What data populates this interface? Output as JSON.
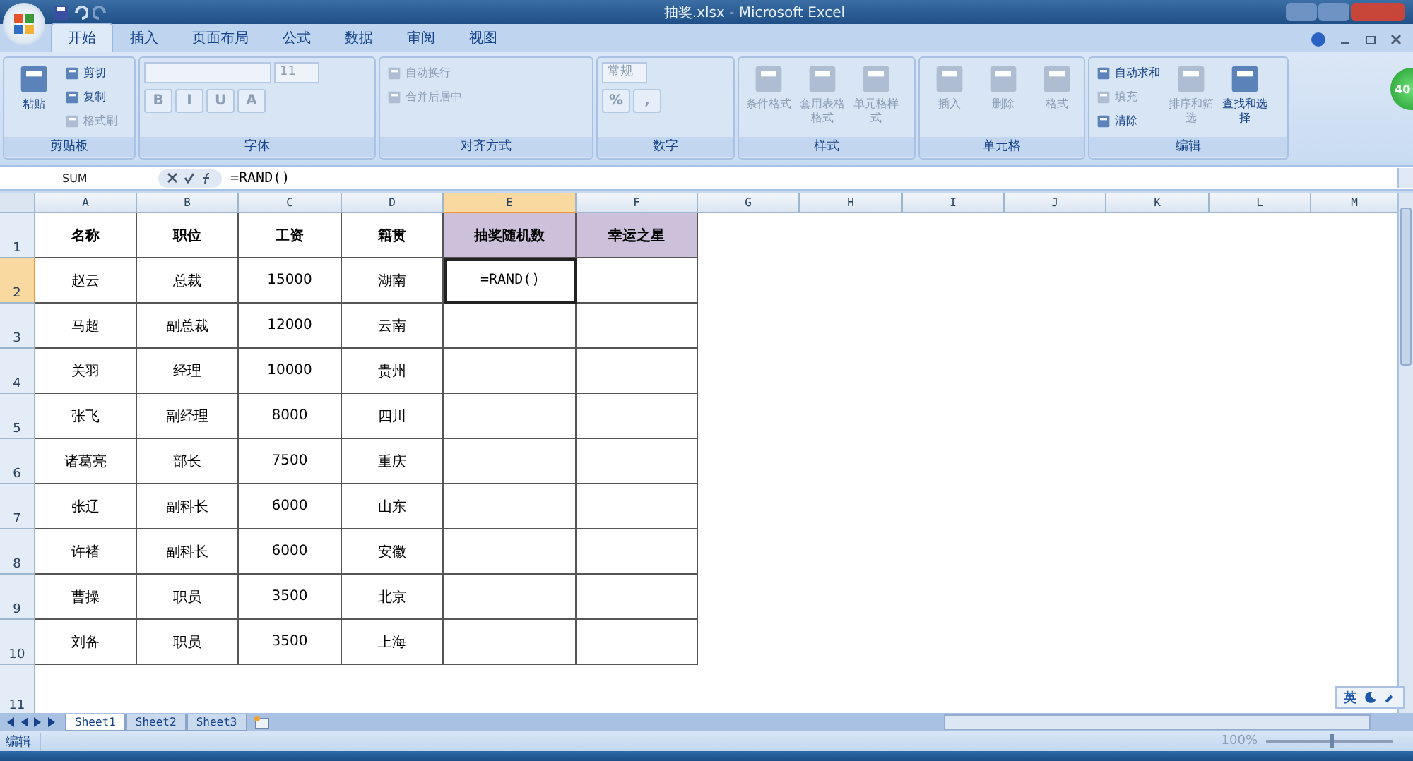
{
  "window": {
    "title": "抽奖.xlsx - Microsoft Excel"
  },
  "ribbon_tabs": [
    {
      "label": "开始",
      "selected": true
    },
    {
      "label": "插入",
      "selected": false
    },
    {
      "label": "页面布局",
      "selected": false
    },
    {
      "label": "公式",
      "selected": false
    },
    {
      "label": "数据",
      "selected": false
    },
    {
      "label": "审阅",
      "selected": false
    },
    {
      "label": "视图",
      "selected": false
    }
  ],
  "floating_badge": "40",
  "ribbon_groups": [
    {
      "title": "剪贴板",
      "items": [
        {
          "kind": "large",
          "label": "粘贴",
          "disabled": false
        },
        {
          "kind": "small",
          "label": "剪切",
          "disabled": false
        },
        {
          "kind": "small",
          "label": "复制",
          "disabled": false
        },
        {
          "kind": "small",
          "label": "格式刷",
          "disabled": true
        }
      ]
    },
    {
      "title": "字体",
      "items": [
        {
          "kind": "field",
          "disabled": true
        },
        {
          "kind": "field",
          "label": "11",
          "disabled": true
        },
        {
          "kind": "glyph",
          "label": "B",
          "disabled": true
        },
        {
          "kind": "glyph",
          "label": "I",
          "disabled": true
        },
        {
          "kind": "glyph",
          "label": "U",
          "disabled": true
        },
        {
          "kind": "glyph",
          "label": "A",
          "disabled": true
        }
      ]
    },
    {
      "title": "对齐方式",
      "items": [
        {
          "kind": "small",
          "label": "自动换行",
          "disabled": true
        },
        {
          "kind": "small",
          "label": "合并后居中",
          "disabled": true
        }
      ]
    },
    {
      "title": "数字",
      "items": [
        {
          "kind": "field",
          "label": "常规",
          "disabled": true
        },
        {
          "kind": "glyph",
          "label": "%",
          "disabled": true
        },
        {
          "kind": "glyph",
          "label": ",",
          "disabled": true
        }
      ]
    },
    {
      "title": "样式",
      "items": [
        {
          "kind": "large",
          "label": "条件格式",
          "disabled": true
        },
        {
          "kind": "large",
          "label": "套用表格格式",
          "disabled": true
        },
        {
          "kind": "large",
          "label": "单元格样式",
          "disabled": true
        }
      ]
    },
    {
      "title": "单元格",
      "items": [
        {
          "kind": "large",
          "label": "插入",
          "disabled": true
        },
        {
          "kind": "large",
          "label": "删除",
          "disabled": true
        },
        {
          "kind": "large",
          "label": "格式",
          "disabled": true
        }
      ]
    },
    {
      "title": "编辑",
      "items": [
        {
          "kind": "small",
          "label": "自动求和",
          "disabled": false
        },
        {
          "kind": "small",
          "label": "填充",
          "disabled": true
        },
        {
          "kind": "small",
          "label": "清除",
          "disabled": false
        },
        {
          "kind": "large",
          "label": "排序和筛选",
          "disabled": true
        },
        {
          "kind": "large",
          "label": "查找和选择",
          "disabled": false
        }
      ]
    }
  ],
  "formula_bar": {
    "name_box": "SUM",
    "formula": "=RAND()"
  },
  "columns": [
    {
      "label": "A",
      "selected": false
    },
    {
      "label": "B",
      "selected": false
    },
    {
      "label": "C",
      "selected": false
    },
    {
      "label": "D",
      "selected": false
    },
    {
      "label": "E",
      "selected": true
    },
    {
      "label": "F",
      "selected": false
    },
    {
      "label": "G",
      "selected": false
    },
    {
      "label": "H",
      "selected": false
    },
    {
      "label": "I",
      "selected": false
    },
    {
      "label": "J",
      "selected": false
    },
    {
      "label": "K",
      "selected": false
    },
    {
      "label": "L",
      "selected": false
    },
    {
      "label": "M",
      "selected": false
    }
  ],
  "rows": [
    {
      "number": "1",
      "selected": false,
      "kind": "header",
      "cells": [
        "名称",
        "职位",
        "工资",
        "籍贯",
        "抽奖随机数",
        "幸运之星"
      ]
    },
    {
      "number": "2",
      "selected": true,
      "kind": "data",
      "cells": [
        "赵云",
        "总裁",
        "15000",
        "湖南",
        "=RAND()",
        ""
      ]
    },
    {
      "number": "3",
      "selected": false,
      "kind": "data",
      "cells": [
        "马超",
        "副总裁",
        "12000",
        "云南",
        "",
        ""
      ]
    },
    {
      "number": "4",
      "selected": false,
      "kind": "data",
      "cells": [
        "关羽",
        "经理",
        "10000",
        "贵州",
        "",
        ""
      ]
    },
    {
      "number": "5",
      "selected": false,
      "kind": "data",
      "cells": [
        "张飞",
        "副经理",
        "8000",
        "四川",
        "",
        ""
      ]
    },
    {
      "number": "6",
      "selected": false,
      "kind": "data",
      "cells": [
        "诸葛亮",
        "部长",
        "7500",
        "重庆",
        "",
        ""
      ]
    },
    {
      "number": "7",
      "selected": false,
      "kind": "data",
      "cells": [
        "张辽",
        "副科长",
        "6000",
        "山东",
        "",
        ""
      ]
    },
    {
      "number": "8",
      "selected": false,
      "kind": "data",
      "cells": [
        "许褚",
        "副科长",
        "6000",
        "安徽",
        "",
        ""
      ]
    },
    {
      "number": "9",
      "selected": false,
      "kind": "data",
      "cells": [
        "曹操",
        "职员",
        "3500",
        "北京",
        "",
        ""
      ]
    },
    {
      "number": "10",
      "selected": false,
      "kind": "data",
      "cells": [
        "刘备",
        "职员",
        "3500",
        "上海",
        "",
        ""
      ]
    },
    {
      "number": "11",
      "selected": false,
      "kind": "empty",
      "cells": []
    }
  ],
  "sheet_tabs": [
    {
      "label": "Sheet1",
      "selected": true
    },
    {
      "label": "Sheet2",
      "selected": false
    },
    {
      "label": "Sheet3",
      "selected": false
    }
  ],
  "ime_bar": {
    "label": "英"
  },
  "status_bar": {
    "mode": "编辑",
    "zoom": "100%",
    "zoom_slider": {
      "level": 0.5
    }
  }
}
